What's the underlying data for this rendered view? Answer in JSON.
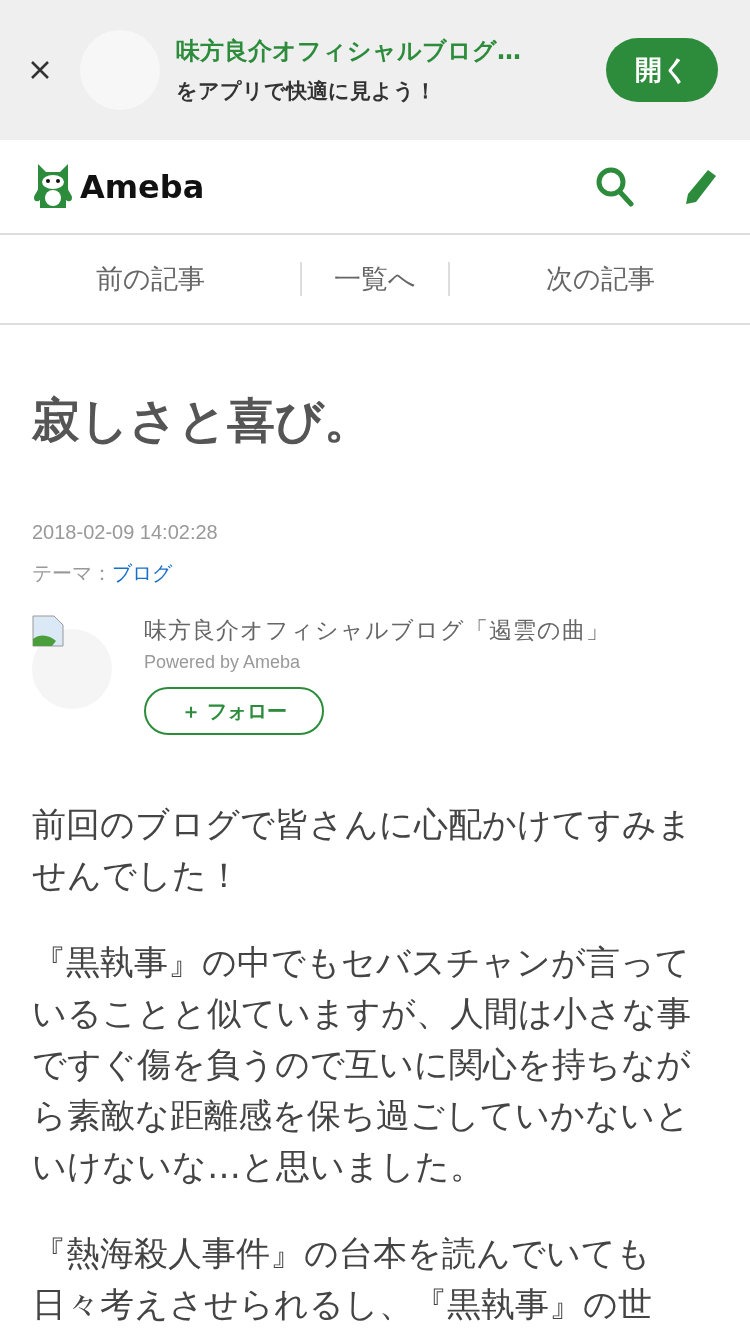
{
  "app_banner": {
    "title": "味方良介オフィシャルブログ…",
    "subtitle": "をアプリで快適に見よう！",
    "button": "開く"
  },
  "header": {
    "logo_text": "Ameba"
  },
  "article_nav": [
    "前の記事",
    "一覧へ",
    "次の記事"
  ],
  "article": {
    "title": "寂しさと喜び。",
    "date": "2018-02-09 14:02:28",
    "theme_label": "テーマ：",
    "theme_link": "ブログ",
    "blog_name": "味方良介オフィシャルブログ「遏雲の曲」",
    "powered_by": "Powered by Ameba",
    "follow_button": "＋ フォロー",
    "paragraphs": [
      "前回のブログで皆さんに心配かけてすみませんでした！",
      "『黒執事』の中でもセバスチャンが言っていることと似ていますが、人間は小さな事ですぐ傷を負うので互いに関心を持ちながら素敵な距離感を保ち過ごしていかないといけないな…と思いました。",
      "『熱海殺人事件』の台本を読んでいても日々考えさせられるし、『黒執事』の世"
    ]
  }
}
